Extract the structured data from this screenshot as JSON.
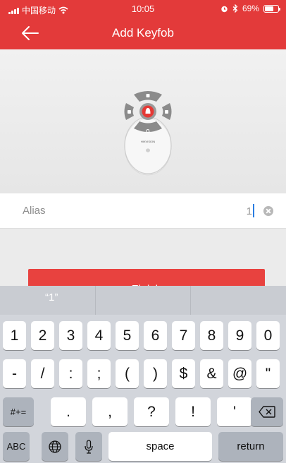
{
  "status_bar": {
    "carrier": "中国移动",
    "time": "10:05",
    "battery": "69%",
    "battery_level": 0.69
  },
  "nav": {
    "title": "Add Keyfob",
    "back_icon": "arrow-left-icon"
  },
  "device_image": {
    "brand_text": "HIKVISION"
  },
  "form": {
    "alias_label": "Alias",
    "alias_value": "1"
  },
  "finish_label": "Finish",
  "keyboard": {
    "suggestions": [
      "“1”",
      "",
      ""
    ],
    "row1": [
      "1",
      "2",
      "3",
      "4",
      "5",
      "6",
      "7",
      "8",
      "9",
      "0"
    ],
    "row2": [
      "-",
      "/",
      ":",
      ";",
      "(",
      ")",
      "$",
      "&",
      "@",
      "\""
    ],
    "row3_left": "#+=",
    "row3": [
      ".",
      ",",
      "?",
      "!",
      "'"
    ],
    "row4": {
      "abc": "ABC",
      "space": "space",
      "return": "return"
    }
  },
  "colors": {
    "header_red": "#e33a3a",
    "finish_red": "#e8423f",
    "keyboard_bg": "#d2d5db",
    "cursor_blue": "#2a7de1"
  }
}
